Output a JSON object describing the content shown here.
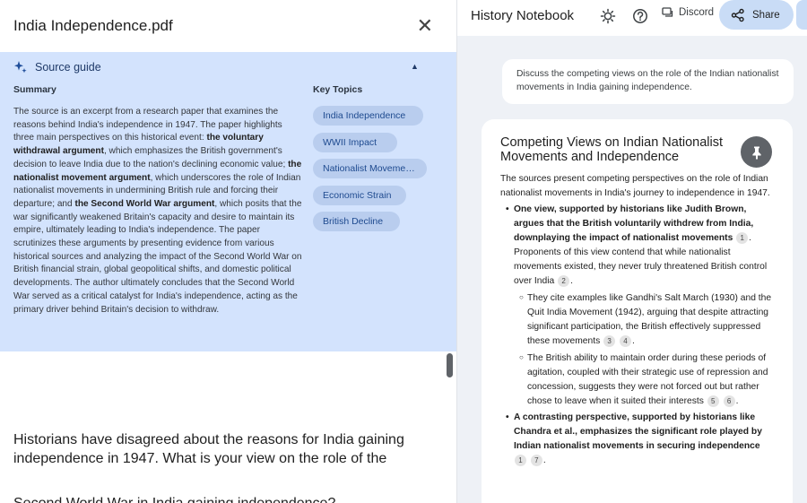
{
  "source_panel": {
    "title": "India Independence.pdf",
    "close_icon": "close-icon"
  },
  "source_guide": {
    "title": "Source guide",
    "summary_heading": "Summary",
    "summary": [
      {
        "t": "The source is an excerpt from a research paper that examines the reasons behind India's independence in 1947. The paper highlights three main perspectives on this historical event: ",
        "b": false
      },
      {
        "t": "the voluntary withdrawal argument",
        "b": true
      },
      {
        "t": ", which emphasizes the British government's decision to leave India due to the nation's declining economic value; ",
        "b": false
      },
      {
        "t": "the nationalist movement argument",
        "b": true
      },
      {
        "t": ", which underscores the role of Indian nationalist movements in undermining British rule and forcing their departure; and ",
        "b": false
      },
      {
        "t": "the Second World War argument",
        "b": true
      },
      {
        "t": ", which posits that the war significantly weakened Britain's capacity and desire to maintain its empire, ultimately leading to India's independence. The paper scrutinizes these arguments by presenting evidence from various historical sources and analyzing the impact of the Second World War on British financial strain, global geopolitical shifts, and domestic political developments. The author ultimately concludes that the Second World War served as a critical catalyst for India's independence, acting as the primary driver behind Britain's decision to withdraw.",
        "b": false
      }
    ],
    "key_topics_heading": "Key Topics",
    "key_topics": [
      "India Independence",
      "WWII Impact",
      "Nationalist Movements",
      "Economic Strain",
      "British Decline"
    ]
  },
  "document": {
    "question": "Historians have disagreed about the reasons for India gaining  independence in 1947. What is your view on the role of the",
    "question_next": "Second World War in India gaining independence?"
  },
  "notebook": {
    "title": "History Notebook",
    "discord_label": "Discord",
    "share_label": "Share",
    "query": "Discuss the competing views on the role of the Indian nationalist movements in India gaining independence.",
    "answer_title": "Competing Views on Indian Nationalist Movements and Independence",
    "intro": "The sources present competing perspectives on the role of Indian nationalist movements in India's journey to independence in 1947.",
    "bullets": [
      {
        "bold": "One view, supported by historians like Judith Brown, argues that the British voluntarily withdrew from India, downplaying the impact of nationalist movements",
        "bold_cites": [
          "1"
        ],
        "text": "Proponents of this view contend that while nationalist movements existed, they never truly threatened British control over India",
        "text_cites": [
          "2"
        ],
        "sub": [
          {
            "text": "They cite examples like Gandhi's Salt March (1930) and the Quit India Movement (1942), arguing that despite attracting significant participation, the British effectively suppressed these movements",
            "cites": [
              "3",
              "4"
            ]
          },
          {
            "text": "The British ability to maintain order during these periods of agitation, coupled with their strategic use of repression and concession, suggests they were not forced out but rather chose to leave when it suited their interests",
            "cites": [
              "5",
              "6"
            ]
          }
        ]
      },
      {
        "bold": "A contrasting perspective, supported by historians like Chandra et al., emphasizes the significant role played by Indian nationalist movements in securing independence",
        "bold_cites": [
          "1",
          "7"
        ],
        "text": "",
        "text_cites": [],
        "sub": []
      }
    ]
  },
  "colors": {
    "guide_bg": "#d3e3fd",
    "chip_bg": "#b9cdee",
    "chip_text": "#1e4a8f",
    "share_bg": "#c9dcf6",
    "notebook_bg": "#eef1f6",
    "pin_bg": "#5f6368"
  }
}
